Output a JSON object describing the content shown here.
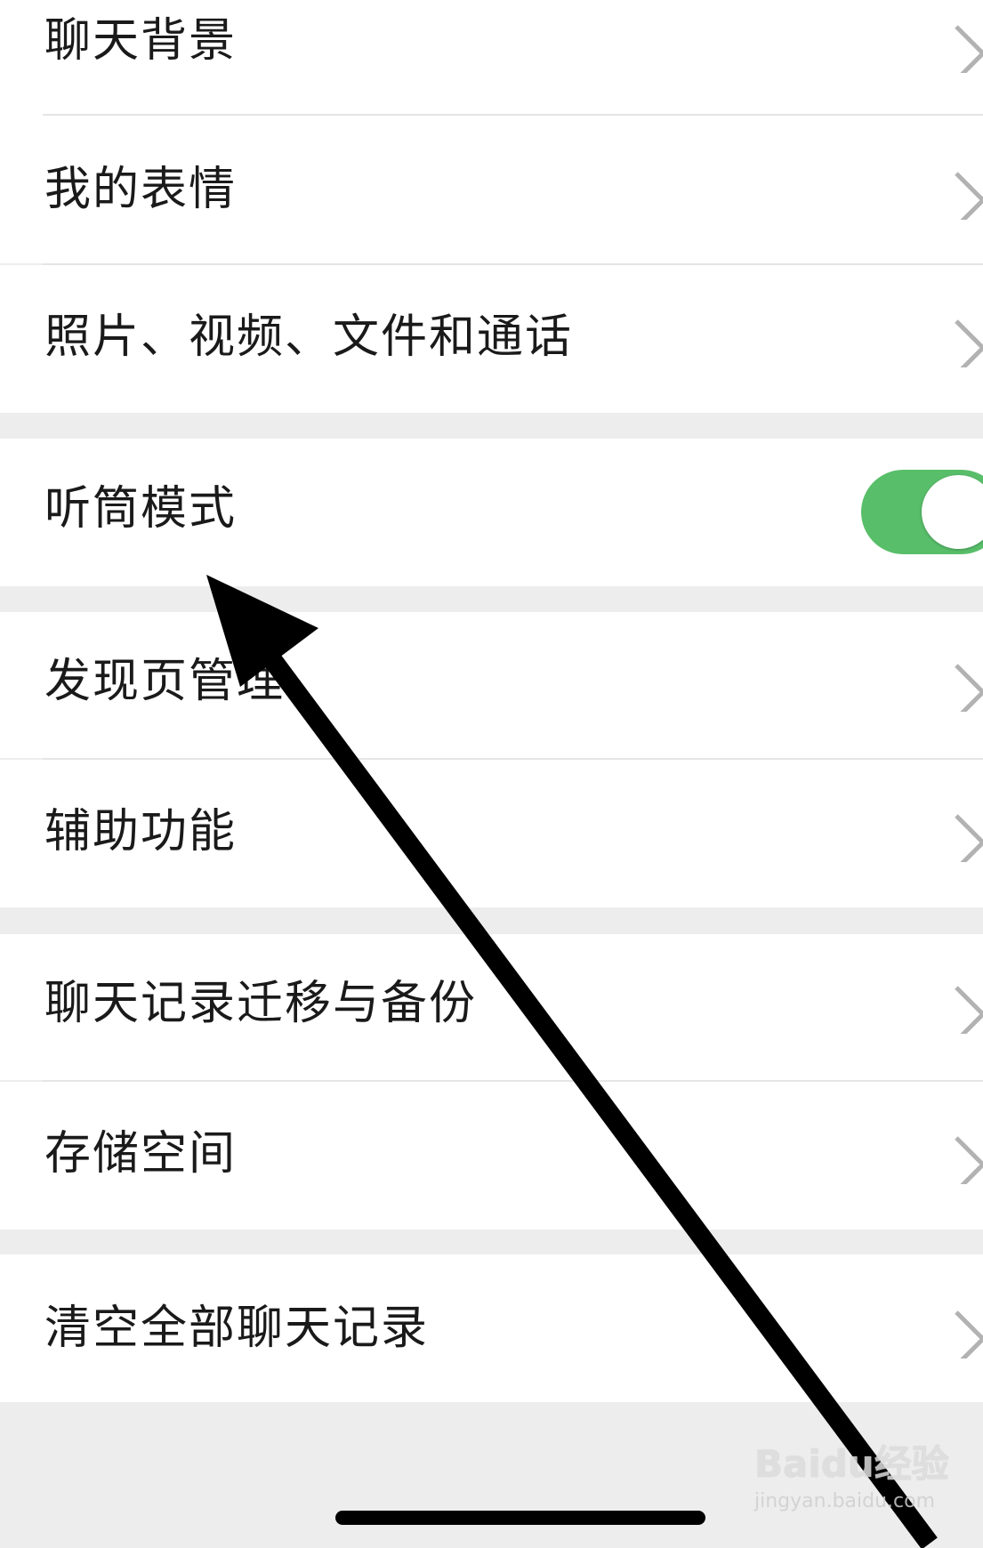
{
  "settings": {
    "rows": [
      {
        "label": "聊天背景"
      },
      {
        "label": "我的表情"
      },
      {
        "label": "照片、视频、文件和通话"
      },
      {
        "label": "听筒模式",
        "toggle": true
      },
      {
        "label": "发现页管理"
      },
      {
        "label": "辅助功能"
      },
      {
        "label": "聊天记录迁移与备份"
      },
      {
        "label": "存储空间"
      },
      {
        "label": "清空全部聊天记录"
      }
    ],
    "earpiece_mode_enabled": true
  },
  "watermark": {
    "logo": "Baidu经验",
    "url": "jingyan.baidu.com"
  },
  "colors": {
    "toggle_on": "#58be6a",
    "background": "#ededed",
    "cell": "#ffffff"
  },
  "icons": [
    "chevron-right-icon",
    "arrow-annotation"
  ]
}
